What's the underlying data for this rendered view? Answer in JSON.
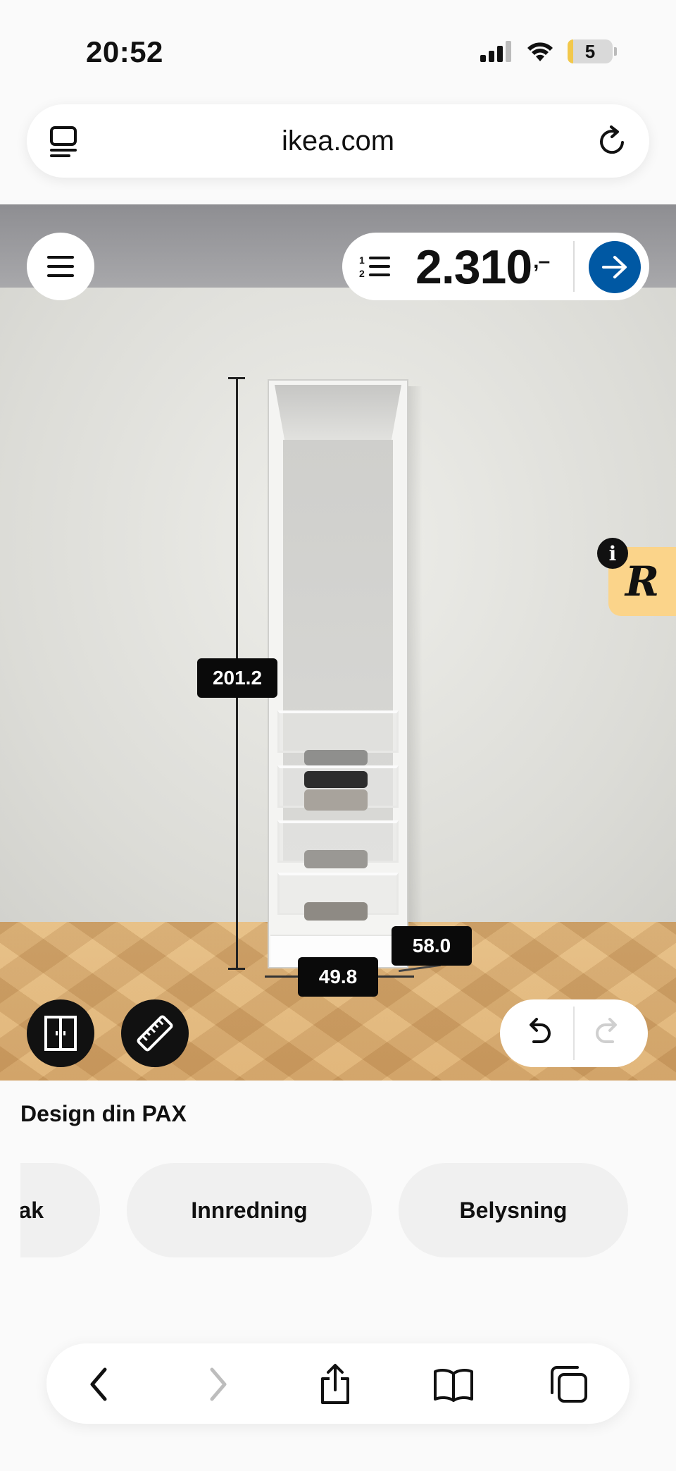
{
  "status_bar": {
    "time": "20:52",
    "battery_level": "5"
  },
  "browser": {
    "url": "ikea.com"
  },
  "cart": {
    "price": "2.310",
    "price_suffix": ",–"
  },
  "dimensions": {
    "height": "201.2",
    "depth": "58.0",
    "width": "49.8"
  },
  "badge": {
    "letter": "R",
    "info": "i"
  },
  "panel": {
    "title": "Design din PAX",
    "categories": [
      {
        "label": "ak"
      },
      {
        "label": "Innredning"
      },
      {
        "label": "Belysning"
      }
    ]
  },
  "colors": {
    "accent": "#0058a3",
    "badge": "#fbd48a",
    "floor": "#dcae72"
  }
}
